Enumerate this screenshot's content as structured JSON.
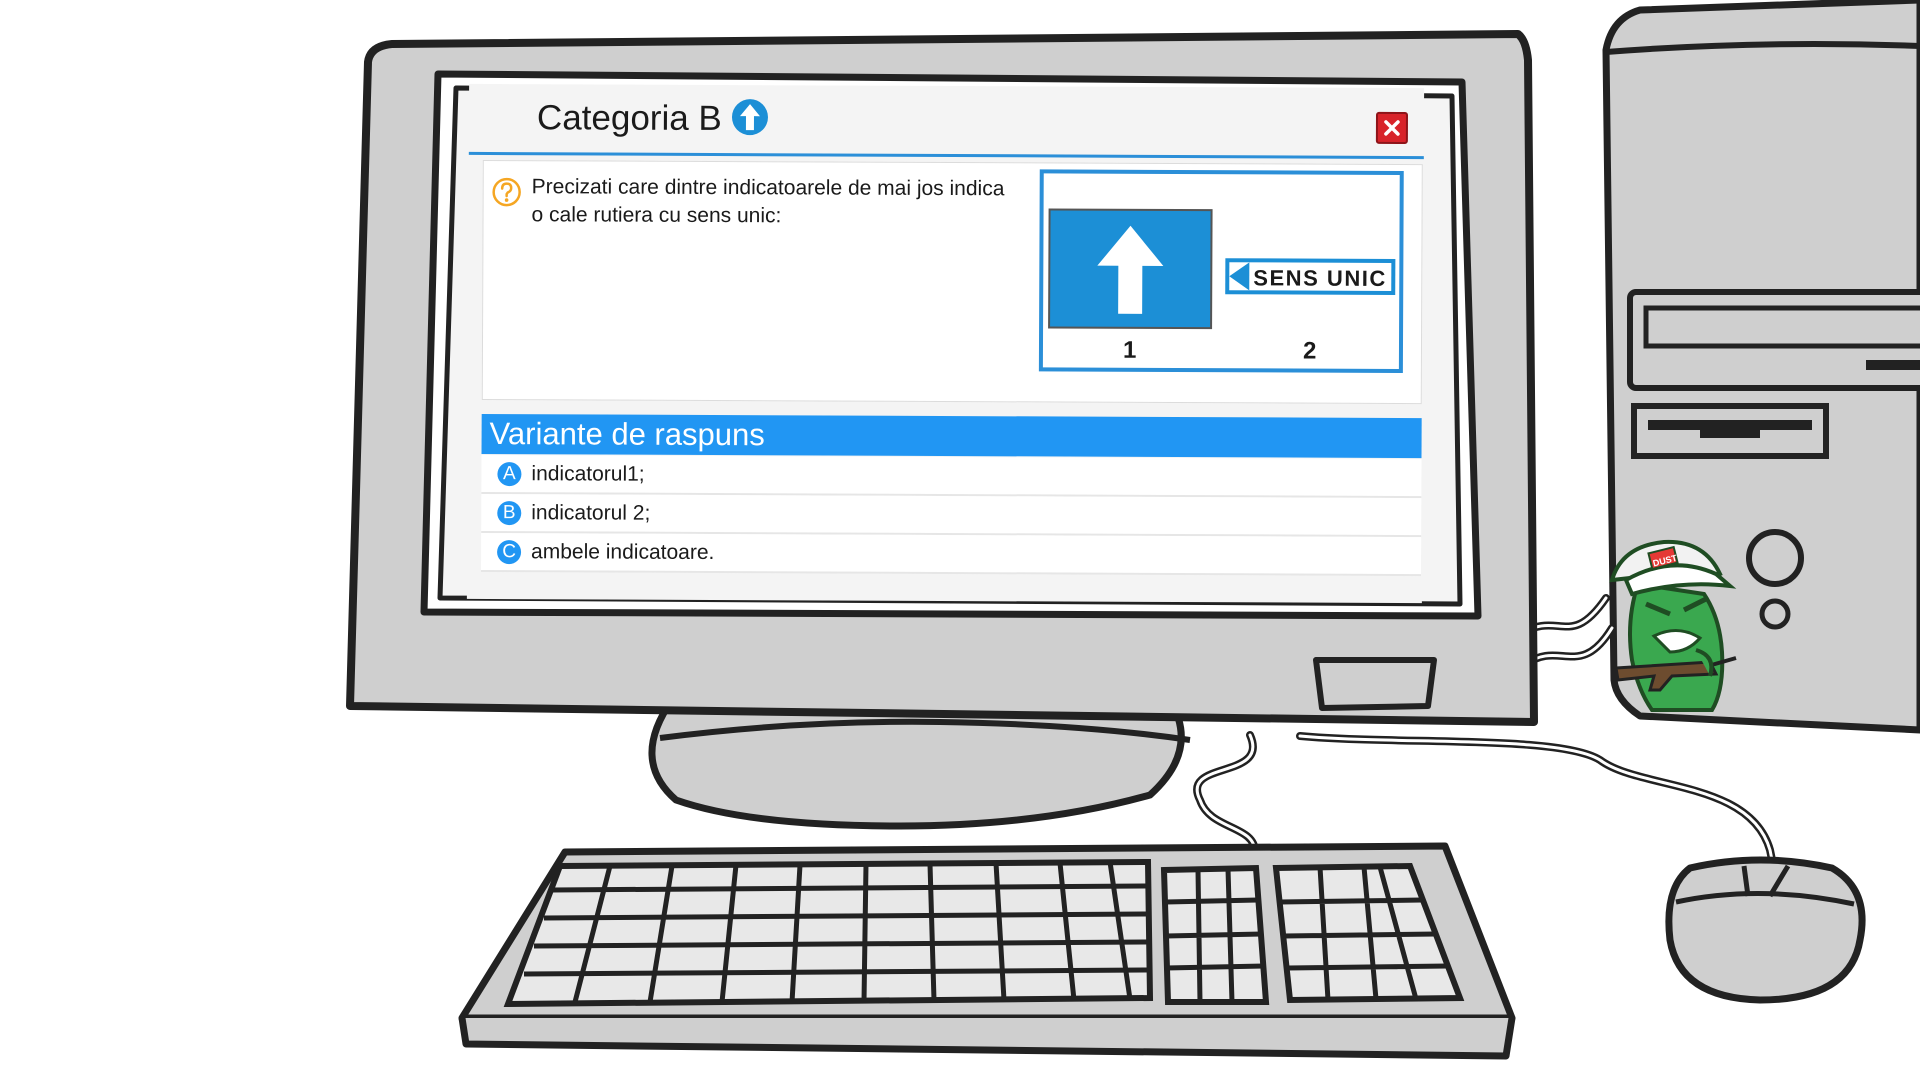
{
  "quiz": {
    "title": "Categoria B",
    "close_icon": "close-icon",
    "category_icon": "arrow-up-icon",
    "question": {
      "icon": "question-icon",
      "text": "Precizati care dintre indicatoarele de mai jos indica o cale rutiera cu sens unic:"
    },
    "figure": {
      "signs": [
        {
          "label": "1",
          "icon": "arrow-up-sign"
        },
        {
          "label": "2",
          "icon": "one-way-sign",
          "text": "SENS UNIC"
        }
      ]
    },
    "answers_header": "Variante de raspuns",
    "answers": [
      {
        "letter": "A",
        "text": "indicatorul1;"
      },
      {
        "letter": "B",
        "text": "indicatorul 2;"
      },
      {
        "letter": "C",
        "text": "ambele indicatoare."
      }
    ]
  },
  "mascot": {
    "cap_text": "DUST"
  },
  "colors": {
    "accent": "#2196f3",
    "sign_blue": "#1c8fd6",
    "close_red": "#d8232a",
    "question_orange": "#f5a623",
    "hardware_gray": "#cfcfcf",
    "outline": "#222222",
    "mascot_green": "#3aa84f"
  }
}
